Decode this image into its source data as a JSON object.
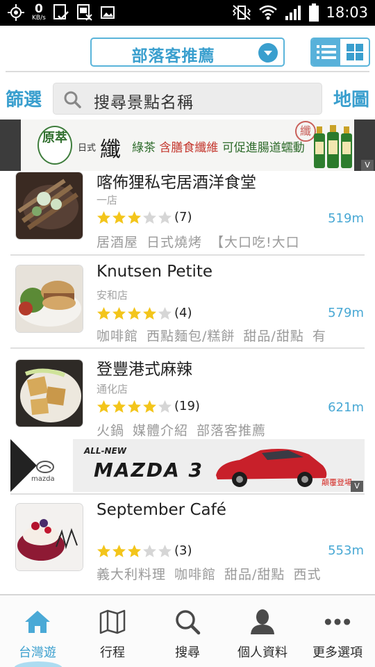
{
  "status_bar": {
    "net_speed": "0",
    "net_unit": "KB/s",
    "time": "18:03"
  },
  "header": {
    "dropdown_label": "部落客推薦",
    "chevron_icon": "chevron-down-icon",
    "view_toggle": [
      {
        "icon": "list-view-icon",
        "active": true
      },
      {
        "icon": "grid-view-icon",
        "active": false
      }
    ]
  },
  "search": {
    "filter_label": "篩選",
    "placeholder": "搜尋景點名稱",
    "map_label": "地圖"
  },
  "ads": {
    "top": {
      "logo": "原萃",
      "small": "日式",
      "big": "纖",
      "text_a": "綠茶",
      "text_b": "含膳食纖維",
      "text_c": "可促進腸道蠕動",
      "stamp": "纖",
      "close": "V"
    },
    "middle": {
      "brand": "mazda",
      "allnew": "ALL-NEW",
      "model": "MAZDA 3",
      "cta": "顛覆登場",
      "close": "V"
    }
  },
  "list": [
    {
      "name": "喀佈狸私宅居酒洋食堂",
      "branch": "一店",
      "rating": 3,
      "reviews": "(7)",
      "distance": "519m",
      "tags": [
        "居酒屋",
        "日式燒烤",
        "【大口吃!大口"
      ]
    },
    {
      "name": "Knutsen Petite",
      "branch": "安和店",
      "rating": 4,
      "reviews": "(4)",
      "distance": "579m",
      "tags": [
        "咖啡館",
        "西點麵包/糕餅",
        "甜品/甜點",
        "有"
      ]
    },
    {
      "name": "登豐港式麻辣",
      "branch": "通化店",
      "rating": 4,
      "reviews": "(19)",
      "distance": "621m",
      "tags": [
        "火鍋",
        "媒體介紹",
        "部落客推薦"
      ]
    },
    {
      "name": "September Café",
      "branch": "",
      "rating": 3,
      "reviews": "(3)",
      "distance": "553m",
      "tags": [
        "義大利料理",
        "咖啡館",
        "甜品/甜點",
        "西式"
      ]
    }
  ],
  "tabbar": [
    {
      "label": "台灣遊",
      "icon": "home-icon",
      "active": true
    },
    {
      "label": "行程",
      "icon": "map-icon",
      "active": false
    },
    {
      "label": "搜尋",
      "icon": "search-icon",
      "active": false
    },
    {
      "label": "個人資料",
      "icon": "person-icon",
      "active": false
    },
    {
      "label": "更多選項",
      "icon": "more-icon",
      "active": false
    }
  ],
  "colors": {
    "accent": "#3a9fce",
    "star_filled": "#f3c51b",
    "star_empty": "#d6d6d6"
  }
}
